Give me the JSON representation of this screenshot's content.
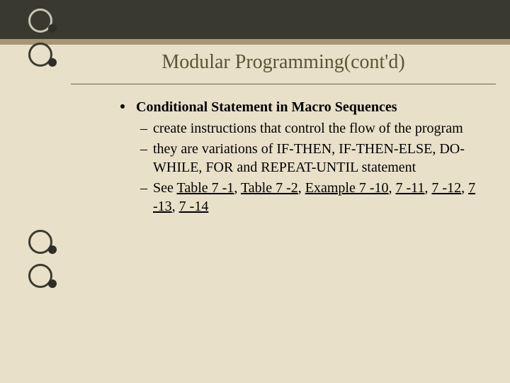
{
  "title": "Modular Programming(cont'd)",
  "bullet": {
    "label": "Conditional Statement in Macro Sequences",
    "subs": {
      "s1": "create instructions that control the flow of the program",
      "s2": "they are variations of IF-THEN, IF-THEN-ELSE, DO-WHILE, FOR and REPEAT-UNTIL statement"
    }
  },
  "see_prefix": "See ",
  "refs": {
    "r1": "Table 7 -1",
    "r2": "Table 7 -2",
    "r3": "Example 7 -10",
    "r4": "7 -11",
    "r5": "7 -12",
    "r6": "7 -13",
    "r7": "7 -14"
  },
  "sep": ", ",
  "dash": "–"
}
